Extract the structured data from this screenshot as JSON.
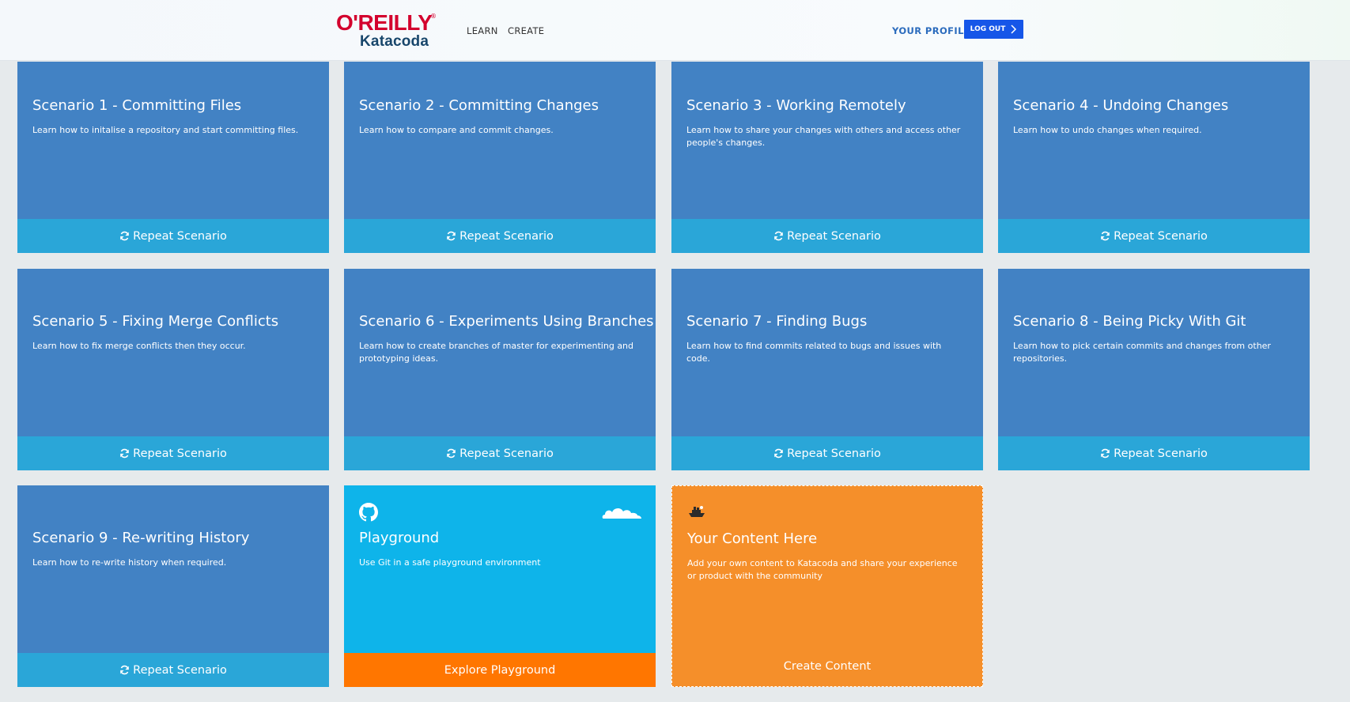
{
  "header": {
    "logo_oreilly": "O'REILLY",
    "logo_reg": "®",
    "logo_katacoda": "Katacoda",
    "nav": {
      "learn": "LEARN",
      "create": "CREATE"
    },
    "profile": "YOUR PROFILE",
    "logout": "LOG OUT"
  },
  "scenarios": [
    {
      "title": "Scenario 1 - Committing Files",
      "desc": "Learn how to initalise a repository and start committing files.",
      "action": "Repeat Scenario"
    },
    {
      "title": "Scenario 2 - Committing Changes",
      "desc": "Learn how to compare and commit changes.",
      "action": "Repeat Scenario"
    },
    {
      "title": "Scenario 3 - Working Remotely",
      "desc": "Learn how to share your changes with others and access other people's changes.",
      "action": "Repeat Scenario"
    },
    {
      "title": "Scenario 4 - Undoing Changes",
      "desc": "Learn how to undo changes when required.",
      "action": "Repeat Scenario"
    },
    {
      "title": "Scenario 5 - Fixing Merge Conflicts",
      "desc": "Learn how to fix merge conflicts then they occur.",
      "action": "Repeat Scenario"
    },
    {
      "title": "Scenario 6 - Experiments Using Branches",
      "desc": "Learn how to create branches of master for experimenting and prototyping ideas.",
      "action": "Repeat Scenario"
    },
    {
      "title": "Scenario 7 - Finding Bugs",
      "desc": "Learn how to find commits related to bugs and issues with code.",
      "action": "Repeat Scenario"
    },
    {
      "title": "Scenario 8 - Being Picky With Git",
      "desc": "Learn how to pick certain commits and changes from other repositories.",
      "action": "Repeat Scenario"
    },
    {
      "title": "Scenario 9 - Re-writing History",
      "desc": "Learn how to re-write history when required.",
      "action": "Repeat Scenario"
    }
  ],
  "playground": {
    "title": "Playground",
    "desc": "Use Git in a safe playground environment",
    "action": "Explore Playground"
  },
  "contribute": {
    "title": "Your Content Here",
    "desc": "Add your own content to Katacoda and share your experience or product with the community",
    "action": "Create Content"
  },
  "colors": {
    "scenario_card": "#4282c4",
    "scenario_footer": "#2aa6d8",
    "playground_card": "#0eb4ea",
    "playground_footer": "#ff7600",
    "contribute_card": "#f58f2a",
    "logout_button": "#1656e8",
    "brand_red": "#d3002d"
  },
  "icons": {
    "repeat": "repeat-icon",
    "playground": "github-icon",
    "playground_decor": "cloud-icon",
    "contribute": "ship-icon",
    "logout": "chevron-right-icon"
  }
}
